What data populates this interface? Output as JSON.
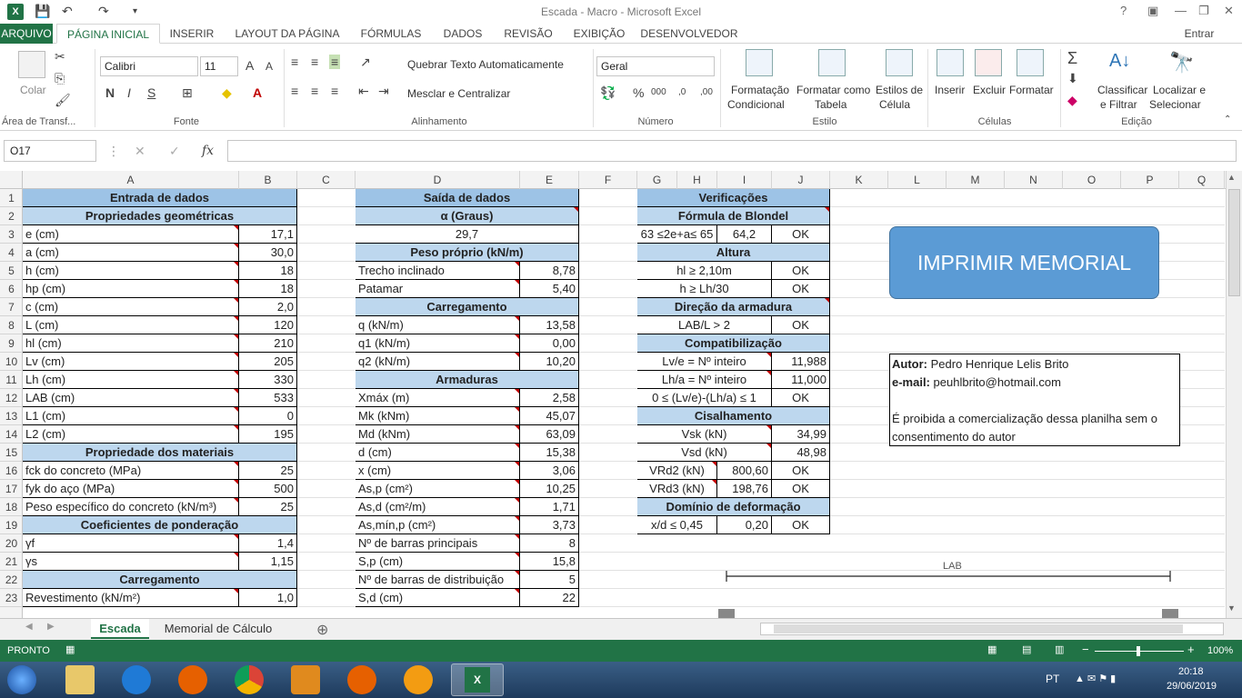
{
  "window": {
    "title": "Escada - Macro - Microsoft Excel",
    "help": "?",
    "signin": "Entrar"
  },
  "tabs": [
    "ARQUIVO",
    "PÁGINA INICIAL",
    "INSERIR",
    "LAYOUT DA PÁGINA",
    "FÓRMULAS",
    "DADOS",
    "REVISÃO",
    "EXIBIÇÃO",
    "DESENVOLVEDOR"
  ],
  "ribbon": {
    "paste": "Colar",
    "clipboard": "Área de Transf...",
    "font_name": "Calibri",
    "font_size": "11",
    "font_group": "Fonte",
    "bold": "N",
    "italic": "I",
    "underline": "S",
    "wrap": "Quebrar Texto Automaticamente",
    "merge": "Mesclar e Centralizar",
    "align_group": "Alinhamento",
    "number_format": "Geral",
    "number_group": "Número",
    "cond_format_1": "Formatação",
    "cond_format_2": "Condicional",
    "table_format_1": "Formatar como",
    "table_format_2": "Tabela",
    "cell_styles_1": "Estilos de",
    "cell_styles_2": "Célula",
    "styles_group": "Estilo",
    "insert": "Inserir",
    "delete": "Excluir",
    "format": "Formatar",
    "cells_group": "Células",
    "sort_1": "Classificar",
    "sort_2": "e Filtrar",
    "find_1": "Localizar e",
    "find_2": "Selecionar",
    "edit_group": "Edição"
  },
  "formula_bar": {
    "name_box": "O17",
    "fx": "fx",
    "value": ""
  },
  "columns": [
    "A",
    "B",
    "C",
    "D",
    "E",
    "F",
    "G",
    "H",
    "I",
    "J",
    "K",
    "L",
    "M",
    "N",
    "O",
    "P",
    "Q"
  ],
  "rows": [
    "1",
    "2",
    "3",
    "4",
    "5",
    "6",
    "7",
    "8",
    "9",
    "10",
    "11",
    "12",
    "13",
    "14",
    "15",
    "16",
    "17",
    "18",
    "19",
    "20",
    "21",
    "22",
    "23"
  ],
  "entrada": {
    "title": "Entrada de dados",
    "geo": "Propriedades geométricas",
    "items": [
      [
        "e (cm)",
        "17,1"
      ],
      [
        "a (cm)",
        "30,0"
      ],
      [
        "h (cm)",
        "18"
      ],
      [
        "hp (cm)",
        "18"
      ],
      [
        "c (cm)",
        "2,0"
      ],
      [
        "L (cm)",
        "120"
      ],
      [
        "hl (cm)",
        "210"
      ],
      [
        "Lv (cm)",
        "205"
      ],
      [
        "Lh (cm)",
        "330"
      ],
      [
        "LAB (cm)",
        "533"
      ],
      [
        "L1 (cm)",
        "0"
      ],
      [
        "L2 (cm)",
        "195"
      ]
    ],
    "mat": "Propriedade dos materiais",
    "mat_items": [
      [
        "fck do concreto (MPa)",
        "25"
      ],
      [
        "fyk do aço (MPa)",
        "500"
      ],
      [
        "Peso específico do concreto (kN/m³)",
        "25"
      ]
    ],
    "coef": "Coeficientes de ponderação",
    "coef_items": [
      [
        "γf",
        "1,4"
      ],
      [
        "γs",
        "1,15"
      ]
    ],
    "carr": "Carregamento",
    "carr_items": [
      [
        "Revestimento (kN/m²)",
        "1,0"
      ]
    ]
  },
  "saida": {
    "title": "Saída de dados",
    "alpha": "α (Graus)",
    "alpha_val": "29,7",
    "peso": "Peso próprio (kN/m)",
    "peso_items": [
      [
        "Trecho inclinado",
        "8,78"
      ],
      [
        "Patamar",
        "5,40"
      ]
    ],
    "carr": "Carregamento",
    "carr_items": [
      [
        "q (kN/m)",
        "13,58"
      ],
      [
        "q1 (kN/m)",
        "0,00"
      ],
      [
        "q2 (kN/m)",
        "10,20"
      ]
    ],
    "arm": "Armaduras",
    "arm_items": [
      [
        "Xmáx (m)",
        "2,58"
      ],
      [
        "Mk (kNm)",
        "45,07"
      ],
      [
        "Md (kNm)",
        "63,09"
      ],
      [
        "d (cm)",
        "15,38"
      ],
      [
        "x (cm)",
        "3,06"
      ],
      [
        "As,p (cm²)",
        "10,25"
      ],
      [
        "As,d (cm²/m)",
        "1,71"
      ],
      [
        "As,mín,p (cm²)",
        "3,73"
      ],
      [
        "Nº de barras principais",
        "8"
      ],
      [
        "S,p (cm)",
        "15,8"
      ],
      [
        "Nº de barras de distribuição",
        "5"
      ],
      [
        "S,d (cm)",
        "22"
      ]
    ]
  },
  "verif": {
    "title": "Verificações",
    "blondel": "Fórmula de Blondel",
    "blondel_cond": "63 ≤2e+a≤ 65",
    "blondel_val": "64,2",
    "ok": "OK",
    "altura": "Altura",
    "alt1": "hl ≥ 2,10m",
    "alt2": "h ≥ Lh/30",
    "dir": "Direção da armadura",
    "dir1": "LAB/L > 2",
    "comp": "Compatibilização",
    "comp1": "Lv/e = Nº inteiro",
    "comp1_val": "11,988",
    "comp2": "Lh/a = Nº inteiro",
    "comp2_val": "11,000",
    "comp3": "0 ≤ (Lv/e)-(Lh/a) ≤ 1",
    "cis": "Cisalhamento",
    "vsk": "Vsk (kN)",
    "vsk_val": "34,99",
    "vsd": "Vsd (kN)",
    "vsd_val": "48,98",
    "vrd2": "VRd2 (kN)",
    "vrd2_val": "800,60",
    "vrd3": "VRd3 (kN)",
    "vrd3_val": "198,76",
    "dom": "Domínio de deformação",
    "dom1": "x/d ≤ 0,45",
    "dom1_val": "0,20"
  },
  "button": "IMPRIMIR MEMORIAL",
  "author": {
    "label": "Autor:",
    "name": "Pedro Henrique Lelis Brito",
    "email_label": "e-mail:",
    "email": "peuhlbrito@hotmail.com",
    "notice": "É proibida a comercialização dessa planilha sem o consentimento do autor"
  },
  "drawing_label": "LAB",
  "sheets": [
    "Escada",
    "Memorial de Cálculo"
  ],
  "status": {
    "ready": "PRONTO",
    "zoom": "100%"
  },
  "taskbar": {
    "lang": "PT",
    "time": "20:18",
    "date": "29/06/2019"
  }
}
